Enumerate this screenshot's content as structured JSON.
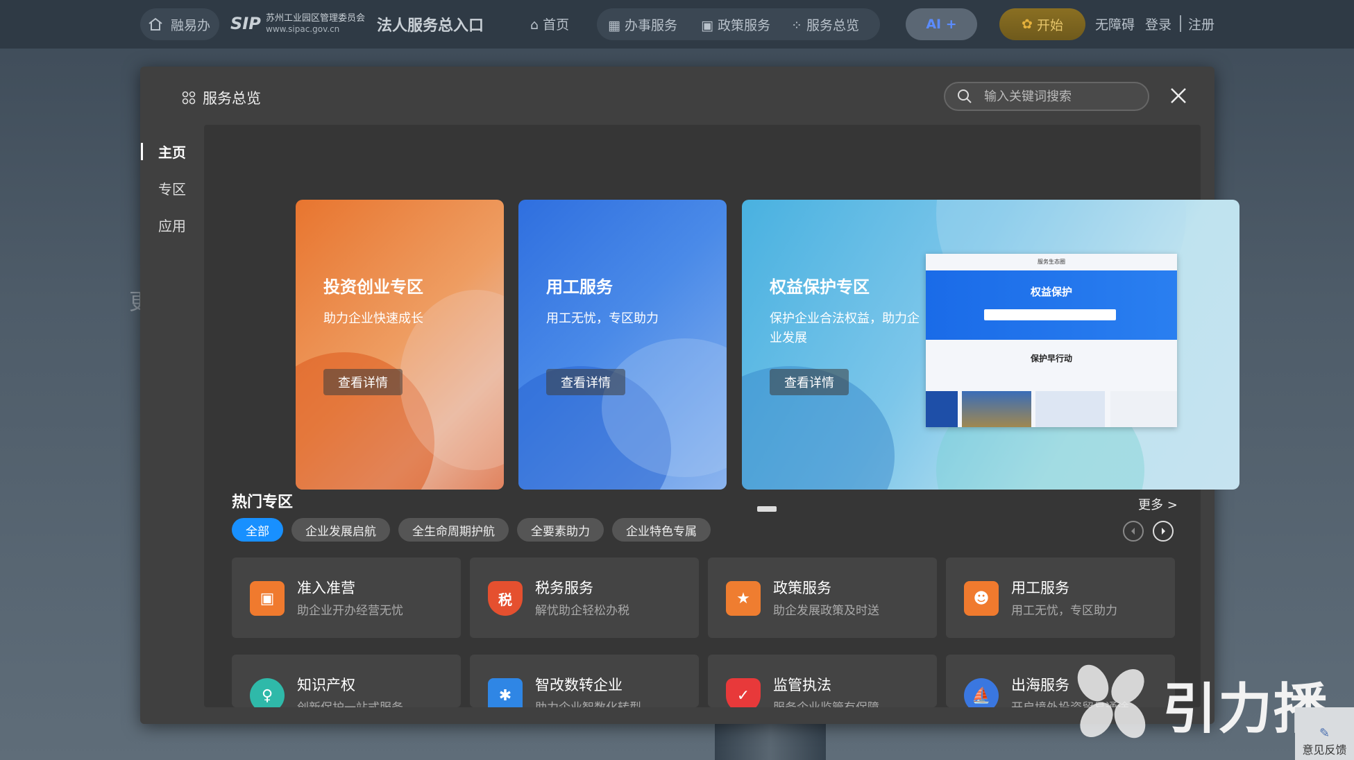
{
  "topbar": {
    "home_label": "融易办",
    "logo_mark": "SIP",
    "logo_org": "苏州工业园区管理委员会",
    "logo_url": "www.sipac.gov.cn",
    "portal_title": "法人服务总入口",
    "nav_home": "首页",
    "nav_affairs": "办事服务",
    "nav_policy": "政策服务",
    "nav_overview": "服务总览",
    "ai_label": "AI +",
    "start_label": "开始",
    "accessibility": "无障碍",
    "login": "登录",
    "register": "注册"
  },
  "modal": {
    "title": "服务总览",
    "search_placeholder": "输入关键词搜索",
    "side_menu": [
      "主页",
      "专区",
      "应用"
    ],
    "banners": [
      {
        "title": "投资创业专区",
        "subtitle": "助力企业快速成长",
        "button": "查看详情"
      },
      {
        "title": "用工服务",
        "subtitle": "用工无忧，专区助力",
        "button": "查看详情"
      },
      {
        "title": "权益保护专区",
        "subtitle": "保护企业合法权益，助力企业发展",
        "button": "查看详情"
      }
    ],
    "preview": {
      "top": "服务生态圈",
      "title": "权益保护",
      "section": "保护早行动"
    },
    "hot": {
      "title": "热门专区",
      "more": "更多 >",
      "tabs": [
        "全部",
        "企业发展启航",
        "全生命周期护航",
        "全要素助力",
        "企业特色专属"
      ],
      "cards": [
        {
          "title": "准入准营",
          "subtitle": "助企业开办经营无忧",
          "icon": "box-icon",
          "color": "#f07a2e"
        },
        {
          "title": "税务服务",
          "subtitle": "解忧助企轻松办税",
          "icon": "tax-icon",
          "color": "#e5502f"
        },
        {
          "title": "政策服务",
          "subtitle": "助企发展政策及时送",
          "icon": "policy-icon",
          "color": "#ef7d30"
        },
        {
          "title": "用工服务",
          "subtitle": "用工无忧，专区助力",
          "icon": "worker-icon",
          "color": "#f07a2e"
        },
        {
          "title": "知识产权",
          "subtitle": "创新保护一站式服务",
          "icon": "ip-icon",
          "color": "#2fb9a9"
        },
        {
          "title": "智改数转企业",
          "subtitle": "助力企业智数化转型",
          "icon": "network-icon",
          "color": "#2f86e5"
        },
        {
          "title": "监管执法",
          "subtitle": "服务企业监管有保障",
          "icon": "shield-icon",
          "color": "#e8393a"
        },
        {
          "title": "出海服务",
          "subtitle": "开启境外投资贸易通途",
          "icon": "sail-icon",
          "color": "#3a77e0"
        }
      ]
    }
  },
  "watermark": "引力播",
  "feedback": "意见反馈",
  "bg_fragment": "更"
}
